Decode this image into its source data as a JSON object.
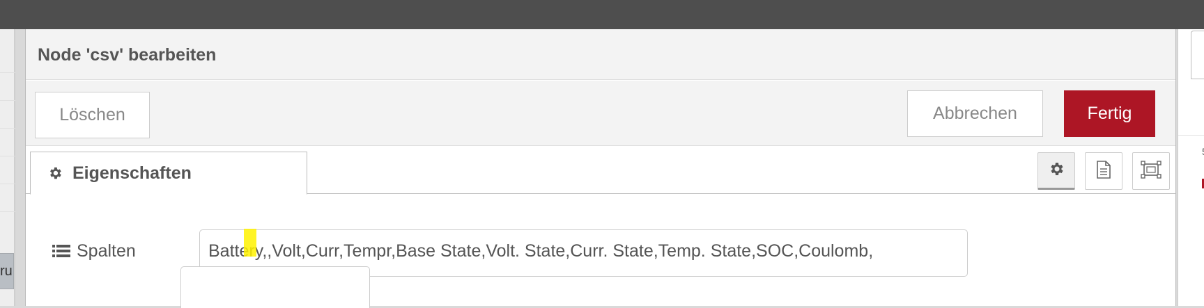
{
  "dialog": {
    "title": "Node 'csv' bearbeiten",
    "buttons": {
      "delete_label": "Löschen",
      "cancel_label": "Abbrechen",
      "done_label": "Fertig"
    },
    "tabs": [
      {
        "label": "Eigenschaften",
        "icon": "gear-icon",
        "active": true
      }
    ],
    "tab_icon_buttons": [
      {
        "icon": "gear-icon",
        "selected": true
      },
      {
        "icon": "document-icon",
        "selected": false
      },
      {
        "icon": "frame-icon",
        "selected": false
      }
    ],
    "form": {
      "columns_label": "Spalten",
      "columns_value": "Battery,,Volt,Curr,Tempr,Base State,Volt. State,Curr. State,Temp. State,SOC,Coulomb,"
    }
  },
  "background": {
    "left_node_stub_text": "ru",
    "right_panel_text": "5"
  },
  "colors": {
    "topbar": "#4e4e4e",
    "primary_button": "#ad1625",
    "highlight": "#fff200"
  }
}
